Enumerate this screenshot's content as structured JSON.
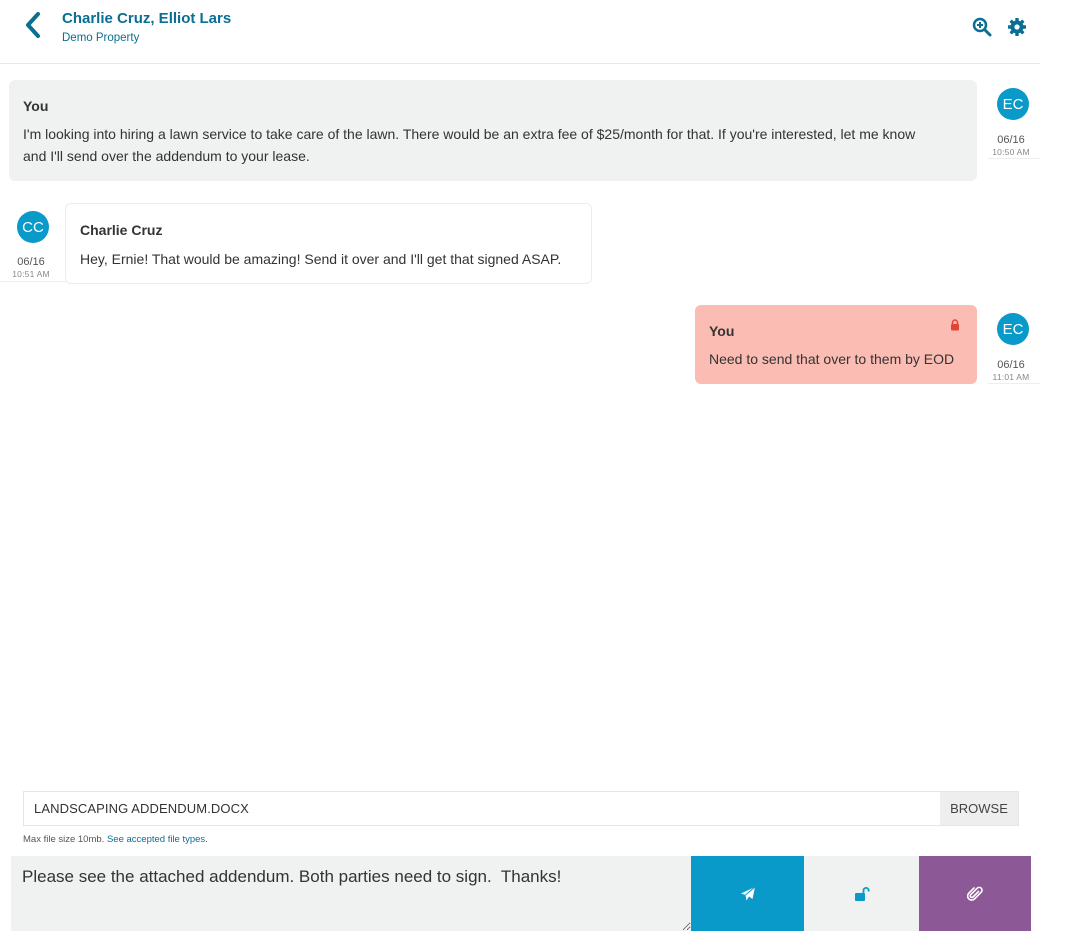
{
  "header": {
    "title": "Charlie Cruz, Elliot Lars",
    "subtitle": "Demo Property"
  },
  "messages": [
    {
      "sender": "You",
      "text_line1": "I'm looking into hiring a lawn service to take care of the lawn. There would be an extra fee of $25/month for that. If you're interested, let me know",
      "text_line2": "and I'll send over the addendum to your lease.",
      "avatar": "EC",
      "date": "06/16",
      "time": "10:50 AM"
    },
    {
      "sender": "Charlie Cruz",
      "text": "Hey, Ernie! That would be amazing! Send it over and I'll get that signed ASAP.",
      "avatar": "CC",
      "date": "06/16",
      "time": "10:51 AM"
    },
    {
      "sender": "You",
      "text": "Need to send that over to them by EOD",
      "avatar": "EC",
      "date": "06/16",
      "time": "11:01 AM",
      "private": true
    }
  ],
  "attachment": {
    "file_name": "LANDSCAPING ADDENDUM.DOCX",
    "browse_label": "BROWSE",
    "note": "Max file size 10mb.",
    "note_link": "See accepted file types."
  },
  "composer": {
    "value": "Please see the attached addendum. Both parties need to sign.  Thanks!"
  },
  "icons": {
    "back": "chevron-left-icon",
    "search": "zoom-in-icon",
    "settings": "gear-icon",
    "send": "paper-plane-icon",
    "private": "unlock-icon",
    "attach": "paperclip-icon"
  },
  "colors": {
    "brand": "#0b6e93",
    "avatar": "#0a9ac9",
    "send": "#0a9ac9",
    "attach": "#8c5896",
    "private_bubble": "#fbbcb3",
    "bubble": "#f0f1f1"
  }
}
